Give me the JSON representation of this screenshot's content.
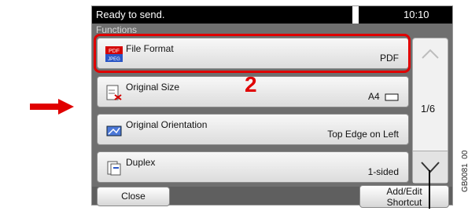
{
  "status_bar": {
    "message": "Ready to send.",
    "time": "10:10"
  },
  "section": {
    "label": "Functions"
  },
  "items": [
    {
      "title": "File Format",
      "value": "PDF",
      "icon": "file-format-icon"
    },
    {
      "title": "Original Size",
      "value": "A4",
      "icon": "original-size-icon"
    },
    {
      "title": "Original Orientation",
      "value": "Top Edge on Left",
      "icon": "orientation-icon"
    },
    {
      "title": "Duplex",
      "value": "1-sided",
      "icon": "duplex-icon"
    }
  ],
  "file_format_icon_text": [
    "PDF",
    "JPEG"
  ],
  "page_indicator": "1/6",
  "callout": {
    "step": "2"
  },
  "buttons": {
    "close": "Close",
    "add_edit_shortcut_line1": "Add/Edit",
    "add_edit_shortcut_line2": "Shortcut"
  },
  "figure_code": "GB0081_00",
  "colors": {
    "highlight": "#e00000",
    "status_bar": "#000000",
    "screen_bg": "#6f6f6f"
  }
}
